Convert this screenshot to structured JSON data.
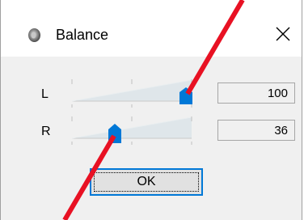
{
  "window": {
    "title": "Balance",
    "close_symbol": "✕",
    "icon": "speaker-icon"
  },
  "channels": [
    {
      "label": "L",
      "value": "100",
      "level": 1.0
    },
    {
      "label": "R",
      "value": "36",
      "level": 0.36
    }
  ],
  "ok_button": {
    "label": "OK"
  },
  "colors": {
    "thumb": "#0078d7",
    "focus_border": "#0078d7",
    "annotation_line": "#e81123"
  }
}
